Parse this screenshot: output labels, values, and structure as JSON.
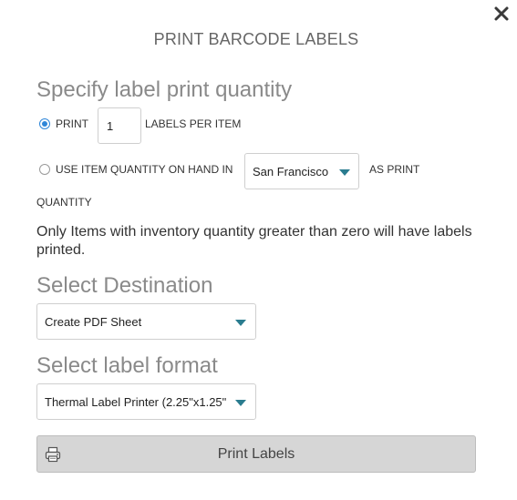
{
  "dialog": {
    "title": "PRINT BARCODE LABELS",
    "close_icon": "close-icon"
  },
  "quantity_section": {
    "heading": "Specify label print quantity",
    "option_print": {
      "label": "PRINT",
      "selected": true,
      "quantity_value": "1",
      "suffix": "LABELS PER ITEM"
    },
    "option_on_hand": {
      "label": "USE ITEM QUANTITY ON HAND IN",
      "selected": false,
      "location_value": "San Francisco",
      "suffix_line1": "AS PRINT",
      "suffix_line2": "QUANTITY"
    },
    "note": "Only Items with inventory quantity greater than zero will have labels printed."
  },
  "destination_section": {
    "heading": "Select Destination",
    "selected_value": "Create PDF Sheet"
  },
  "format_section": {
    "heading": "Select label format",
    "selected_value": "Thermal Label Printer (2.25\"x1.25\""
  },
  "actions": {
    "print_label": "Print Labels",
    "print_icon": "printer-icon"
  },
  "colors": {
    "accent_radio": "#2f86d8",
    "caret": "#2a7c8f",
    "button_bg": "#d6d6d6",
    "heading_gray": "#8a8a8a"
  }
}
